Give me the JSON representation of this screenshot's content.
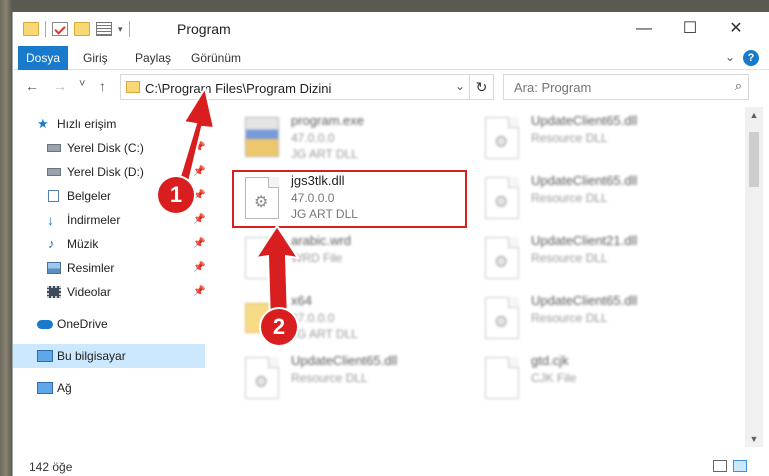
{
  "window": {
    "title": "Program",
    "controls": {
      "minimize": "—",
      "maximize": "☐",
      "close": "✕"
    }
  },
  "ribbon": {
    "tabs": [
      "Dosya",
      "Giriş",
      "Paylaş",
      "Görünüm"
    ],
    "expand": "⌄",
    "help": "?"
  },
  "address": {
    "path": "C:\\Program Files\\Program Dizini",
    "dropdown": "⌄",
    "refresh": "↻"
  },
  "search": {
    "placeholder": "Ara: Program",
    "icon": "⌕"
  },
  "nav_buttons": {
    "back": "←",
    "forward": "→",
    "recent": "˅",
    "up": "↑"
  },
  "sidebar": {
    "items": [
      {
        "label": "Hızlı erişim",
        "icon": "star-icon",
        "pinned": false
      },
      {
        "label": "Yerel Disk (C:)",
        "icon": "drive-icon",
        "pinned": true
      },
      {
        "label": "Yerel Disk (D:)",
        "icon": "drive-icon",
        "pinned": true
      },
      {
        "label": "Belgeler",
        "icon": "documents-icon",
        "pinned": true
      },
      {
        "label": "İndirmeler",
        "icon": "download-icon",
        "pinned": true
      },
      {
        "label": "Müzik",
        "icon": "music-icon",
        "pinned": true
      },
      {
        "label": "Resimler",
        "icon": "pictures-icon",
        "pinned": true
      },
      {
        "label": "Videolar",
        "icon": "videos-icon",
        "pinned": true
      },
      {
        "label": "OneDrive",
        "icon": "cloud-icon",
        "pinned": false
      },
      {
        "label": "Bu bilgisayar",
        "icon": "computer-icon",
        "pinned": false,
        "selected": true
      },
      {
        "label": "Ağ",
        "icon": "network-icon",
        "pinned": false
      }
    ],
    "pin_glyph": "📌"
  },
  "files": [
    {
      "name": "program.exe",
      "line1": "47.0.0.0",
      "line2": "JG ART DLL",
      "kind": "exe"
    },
    {
      "name": "UpdateClient65.dll",
      "line1": "Resource DLL",
      "line2": "",
      "kind": "dll"
    },
    {
      "name": "jgs3tlk.dll",
      "line1": "47.0.0.0",
      "line2": "JG ART DLL",
      "kind": "dll",
      "highlighted": true
    },
    {
      "name": "UpdateClient65.dll",
      "line1": "Resource DLL",
      "line2": "",
      "kind": "dll"
    },
    {
      "name": "arabic.wrd",
      "line1": "WRD File",
      "line2": "",
      "kind": "file"
    },
    {
      "name": "UpdateClient21.dll",
      "line1": "Resource DLL",
      "line2": "",
      "kind": "dll"
    },
    {
      "name": "x64",
      "line1": "47.0.0.0",
      "line2": "JG ART DLL",
      "kind": "folder"
    },
    {
      "name": "UpdateClient65.dll",
      "line1": "Resource DLL",
      "line2": "",
      "kind": "dll"
    },
    {
      "name": "UpdateClient65.dll",
      "line1": "Resource DLL",
      "line2": "",
      "kind": "dll"
    },
    {
      "name": "gtd.cjk",
      "line1": "CJK File",
      "line2": "",
      "kind": "file"
    }
  ],
  "status": {
    "count": "142 öğe"
  },
  "annotations": {
    "step1": "1",
    "step2": "2",
    "accent": "#d81e1e"
  }
}
